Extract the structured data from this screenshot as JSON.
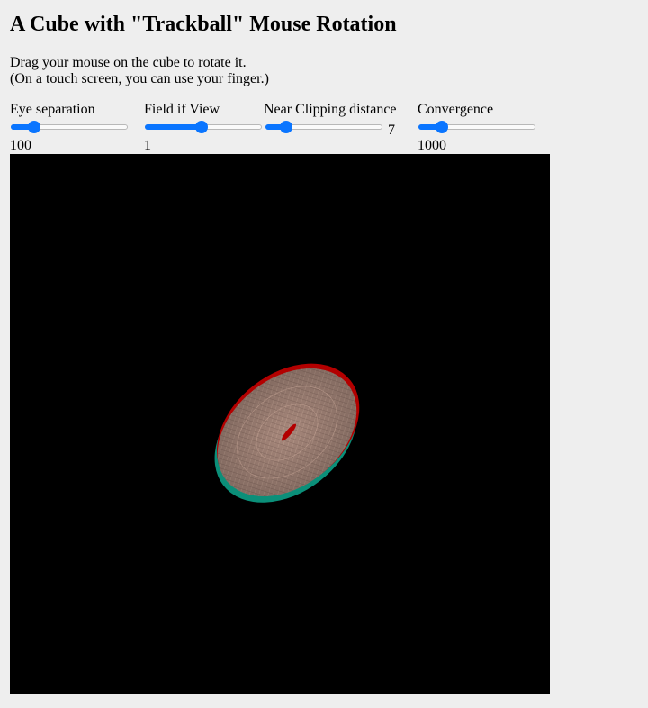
{
  "page": {
    "title": "A Cube with \"Trackball\" Mouse Rotation",
    "instructions": [
      "Drag your mouse on the cube to rotate it.",
      "(On a touch screen, you can use your finger.)"
    ]
  },
  "controls": [
    {
      "label": "Eye separation",
      "value_text": "100",
      "fraction": 0.16
    },
    {
      "label": "Field if View",
      "value_text": "1",
      "fraction": 0.48
    },
    {
      "label": "Near Clipping distance",
      "value_text": "7",
      "fraction": 0.14
    },
    {
      "label": "Convergence",
      "value_text": "1000",
      "fraction": 0.16
    }
  ],
  "colors": {
    "accent": "#0a75ff",
    "canvas_bg": "#000000",
    "cyan_layer": "#0b8f79",
    "red_layer": "#b30000",
    "disc_face": "#b08f82"
  }
}
